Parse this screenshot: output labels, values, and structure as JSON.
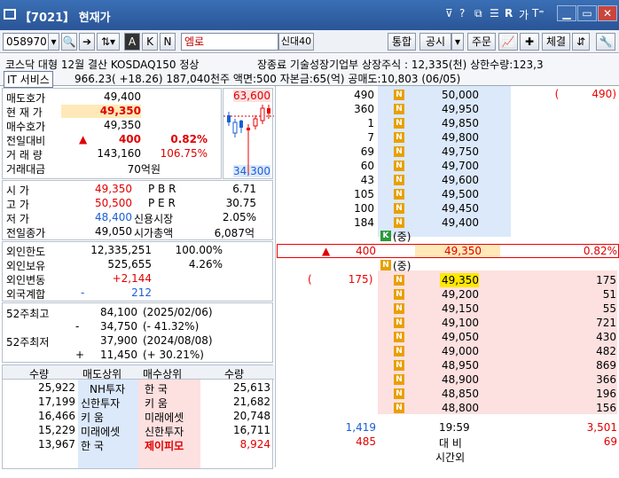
{
  "window": {
    "title": "【7021】 현재가",
    "icons": [
      "dock-icon",
      "help-icon",
      "window-icon",
      "copy-icon",
      "refresh-icon",
      "minimize-icon",
      "restore-icon",
      "close-icon"
    ],
    "help": "?",
    "r_label": "R",
    "ga": "가",
    "tl": "T⁼"
  },
  "toolbar": {
    "code": "058970",
    "name": "엠로",
    "credit": "신대40",
    "k_label": "K",
    "n_label": "N",
    "a_label": "A",
    "buttons": [
      "통합",
      "공시",
      "주문",
      "체결"
    ]
  },
  "info": {
    "line1": "코스닥 대형 12월 결산 KOSDAQ150 정상",
    "line1b": "장종료 기술성장기업부 상장주식 : 12,335(천) 상한수량:123,3",
    "line2a": "IT 서비스",
    "line2b": "966.23( +18.26) 187,040천주 액면:500 자본금:65(억) 공매도:10,803 (06/05)"
  },
  "quote": {
    "rows": [
      {
        "l": "매도호가",
        "v": "49,400"
      },
      {
        "l": "현 재 가",
        "v": "49,350"
      },
      {
        "l": "매수호가",
        "v": "49,350"
      },
      {
        "l": "전일대비",
        "v": "400",
        "p": "0.82%"
      },
      {
        "l": "거 래 량",
        "v": "143,160",
        "p": "106.75%"
      },
      {
        "l": "거래대금",
        "v": "70억원"
      }
    ],
    "chart_high": "63,600",
    "chart_low": "34,300"
  },
  "stats": {
    "rows": [
      {
        "l": "시  가",
        "v": "49,350",
        "l2": "P B R",
        "v2": "6.71"
      },
      {
        "l": "고  가",
        "v": "50,500",
        "l2": "P E R",
        "v2": "30.75"
      },
      {
        "l": "저  가",
        "v": "48,400",
        "l2": "신용시장",
        "v2": "2.05%"
      },
      {
        "l": "전일종가",
        "v": "49,050",
        "l2": "시가총액",
        "v2": "6,087억"
      }
    ]
  },
  "foreign": {
    "rows": [
      {
        "l": "외인한도",
        "v": "12,335,251",
        "p": "100.00%"
      },
      {
        "l": "외인보유",
        "v": "525,655",
        "p": "4.26%"
      },
      {
        "l": "외인변동",
        "v": "+2,144",
        "p": ""
      },
      {
        "l": "외국계합",
        "v": "212",
        "s": "-"
      }
    ]
  },
  "week52": {
    "high_label": "52주최고",
    "high": "84,100",
    "high_date": "(2025/02/06)",
    "high_diff": "34,750",
    "high_pct": "(-  41.32%)",
    "low_label": "52주최저",
    "low": "37,900",
    "low_date": "(2024/08/08)",
    "low_diff": "11,450",
    "low_pct": "(+  30.21%)",
    "minus": "-",
    "plus": "+"
  },
  "broker": {
    "headers": [
      "수량",
      "매도상위",
      "매수상위",
      "수량"
    ],
    "rows": [
      {
        "sq": "25,922",
        "sn": "NH투자",
        "bn": "한    국",
        "bq": "25,613"
      },
      {
        "sq": "17,199",
        "sn": "신한투자",
        "bn": "키    움",
        "bq": "21,682"
      },
      {
        "sq": "16,466",
        "sn": "키    움",
        "bn": "미래에셋",
        "bq": "20,748"
      },
      {
        "sq": "15,229",
        "sn": "미래에셋",
        "bn": "신한투자",
        "bq": "16,711"
      },
      {
        "sq": "13,967",
        "sn": "한    국",
        "bn": "제이피모",
        "bq": "8,924"
      }
    ]
  },
  "orderbook": {
    "asks": [
      {
        "q": "490",
        "p": "50,000"
      },
      {
        "q": "360",
        "p": "49,950"
      },
      {
        "q": "1",
        "p": "49,850"
      },
      {
        "q": "7",
        "p": "49,800"
      },
      {
        "q": "69",
        "p": "49,750"
      },
      {
        "q": "60",
        "p": "49,700"
      },
      {
        "q": "43",
        "p": "49,600"
      },
      {
        "q": "105",
        "p": "49,500"
      },
      {
        "q": "100",
        "p": "49,450"
      },
      {
        "q": "184",
        "p": "49,400"
      }
    ],
    "ask_top": "490",
    "k_label": "K",
    "jung": "(중)",
    "n_label": "N",
    "mid_change": "400",
    "mid_price": "49,350",
    "mid_pct": "0.82%",
    "bid_left": "175",
    "bids": [
      {
        "p": "49,350",
        "q": "175"
      },
      {
        "p": "49,200",
        "q": "51"
      },
      {
        "p": "49,150",
        "q": "55"
      },
      {
        "p": "49,100",
        "q": "721"
      },
      {
        "p": "49,050",
        "q": "430"
      },
      {
        "p": "49,000",
        "q": "482"
      },
      {
        "p": "48,950",
        "q": "869"
      },
      {
        "p": "48,900",
        "q": "366"
      },
      {
        "p": "48,850",
        "q": "196"
      },
      {
        "p": "48,800",
        "q": "156"
      }
    ],
    "ask_total": "1,419",
    "time": "19:59",
    "bid_total": "3,501",
    "diff_ask": "485",
    "diff_label": "대  비",
    "diff_bid": "69",
    "after": "시간외"
  }
}
